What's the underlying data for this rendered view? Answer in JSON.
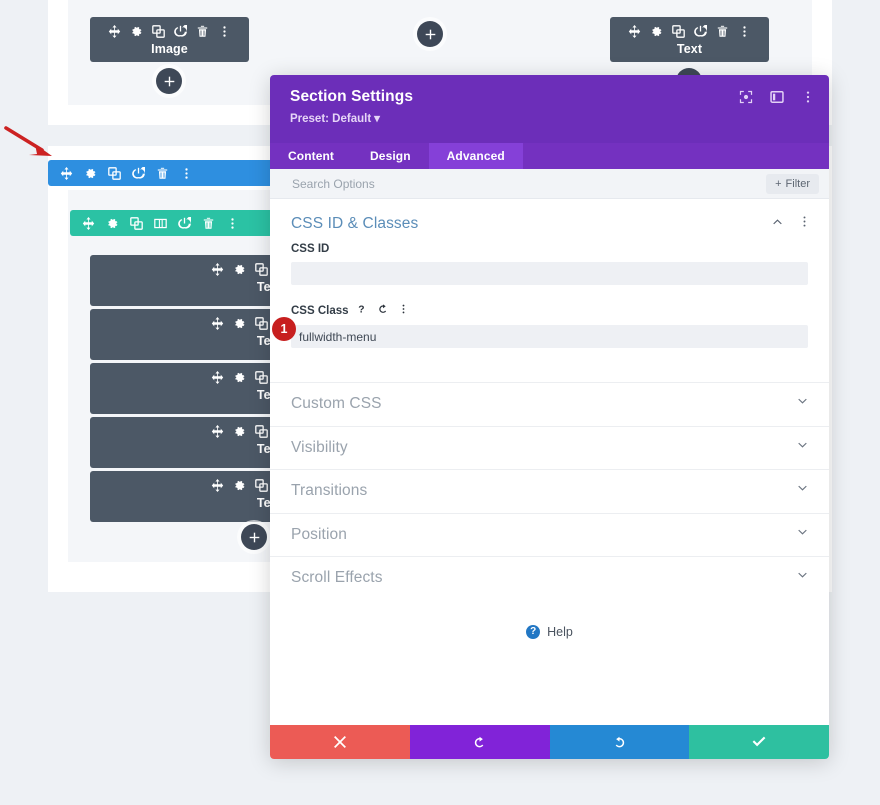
{
  "builder": {
    "modules": [
      {
        "label": "Image",
        "icons": [
          "move-icon",
          "gear-icon",
          "duplicate-icon",
          "power-icon",
          "trash-icon",
          "more-vertical-icon"
        ]
      },
      {
        "label": "Text",
        "icons": [
          "move-icon",
          "gear-icon",
          "duplicate-icon",
          "power-icon",
          "trash-icon",
          "more-vertical-icon"
        ]
      }
    ],
    "text_modules": [
      {
        "label": "Text"
      },
      {
        "label": "Text"
      },
      {
        "label": "Text"
      },
      {
        "label": "Text"
      },
      {
        "label": "Text"
      }
    ],
    "section_bar": {
      "name": "section-toolbar",
      "color": "#2e8fe0",
      "icons": [
        "move-icon",
        "gear-icon",
        "duplicate-icon",
        "power-icon",
        "trash-icon",
        "more-vertical-icon"
      ]
    },
    "row_bar": {
      "name": "row-toolbar",
      "color": "#2bc2a4",
      "icons": [
        "move-icon",
        "gear-icon",
        "duplicate-icon",
        "columns-icon",
        "power-icon",
        "trash-icon",
        "more-vertical-icon"
      ]
    },
    "add_buttons": [
      "add-module-button",
      "add-section-button",
      "add-module-button",
      "add-module-button"
    ],
    "annotation_arrow": "red-arrow-pointing-to-section-toolbar"
  },
  "modal": {
    "title": "Section Settings",
    "preset": "Preset: Default",
    "preset_caret": "▾",
    "header_icons": [
      "fullscreen-icon",
      "layout-panel-icon",
      "more-vertical-icon"
    ],
    "tabs": [
      {
        "label": "Content",
        "active": false
      },
      {
        "label": "Design",
        "active": false
      },
      {
        "label": "Advanced",
        "active": true
      }
    ],
    "search": {
      "placeholder": "Search Options",
      "value": ""
    },
    "filter_button": {
      "label": "Filter",
      "plus": "+"
    },
    "open_section": {
      "title": "CSS ID & Classes",
      "collapse_icon": "chevron-up-icon",
      "more_icon": "more-vertical-icon",
      "fields": [
        {
          "label": "CSS ID",
          "value": "",
          "placeholder": "",
          "icons": []
        },
        {
          "label": "CSS Class",
          "value": "fullwidth-menu",
          "placeholder": "",
          "icons": [
            "help-icon",
            "reset-icon",
            "more-vertical-icon"
          ],
          "step_badge": "1"
        }
      ]
    },
    "collapsed_sections": [
      {
        "title": "Custom CSS",
        "chevron": "chevron-down-icon"
      },
      {
        "title": "Visibility",
        "chevron": "chevron-down-icon"
      },
      {
        "title": "Transitions",
        "chevron": "chevron-down-icon"
      },
      {
        "title": "Position",
        "chevron": "chevron-down-icon"
      },
      {
        "title": "Scroll Effects",
        "chevron": "chevron-down-icon"
      }
    ],
    "help": {
      "label": "Help",
      "mark": "?"
    },
    "footer": [
      {
        "name": "cancel-button",
        "icon": "close-icon",
        "color": "#ec5b55"
      },
      {
        "name": "undo-button",
        "icon": "undo-icon",
        "color": "#8123d8"
      },
      {
        "name": "redo-button",
        "icon": "redo-icon",
        "color": "#2589d4"
      },
      {
        "name": "save-button",
        "icon": "check-icon",
        "color": "#2ec0a0"
      }
    ]
  },
  "colors": {
    "purple_header": "#6c2eb9",
    "tab_bar": "#7431c0",
    "tab_active": "#8540d8",
    "section_blue": "#2e8fe0",
    "row_green": "#2bc2a4",
    "module_slate": "#4c5866",
    "badge_red": "#c71f1f",
    "page_bg": "#eef1f5"
  }
}
